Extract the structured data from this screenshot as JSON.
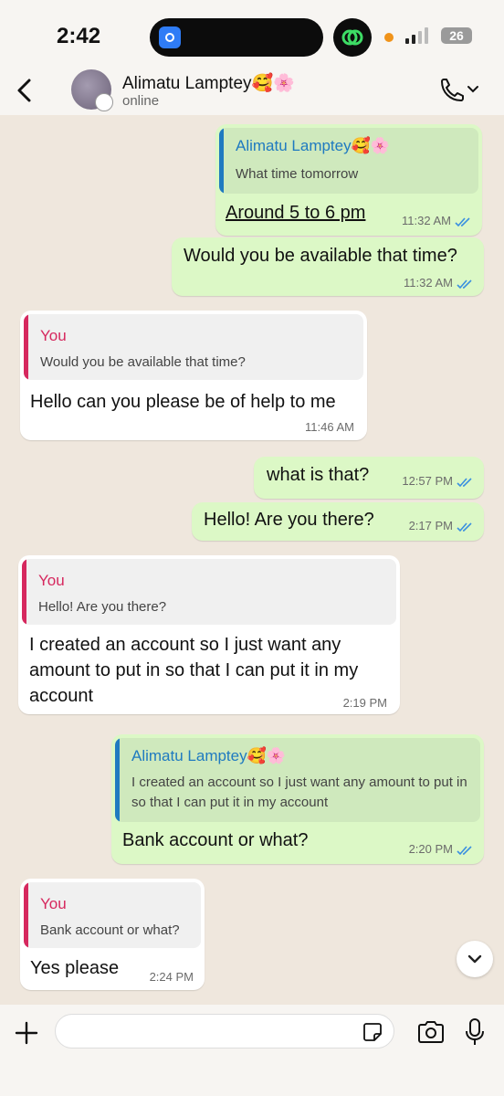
{
  "status_bar": {
    "time": "2:42",
    "battery": "26"
  },
  "header": {
    "contact_name": "Alimatu Lamptey🥰🌸",
    "status": "online"
  },
  "messages": [
    {
      "direction": "out",
      "quote": {
        "author": "Alimatu Lamptey🥰🌸",
        "text": "What time tomorrow"
      },
      "text": "Around 5 to 6 pm",
      "time": "11:32 AM"
    },
    {
      "direction": "out",
      "text": "Would you be available that time?",
      "time": "11:32 AM"
    },
    {
      "direction": "in",
      "quote": {
        "author": "You",
        "text": "Would you be available that time?"
      },
      "text": "Hello can you please be of help to me",
      "time": "11:46 AM"
    },
    {
      "direction": "out",
      "text": "what is that?",
      "time": "12:57 PM"
    },
    {
      "direction": "out",
      "text": "Hello! Are you there?",
      "time": "2:17 PM"
    },
    {
      "direction": "in",
      "quote": {
        "author": "You",
        "text": "Hello! Are you there?"
      },
      "text": "I created an account so I just want any amount to put in so that I can put it in my account",
      "time": "2:19 PM"
    },
    {
      "direction": "out",
      "quote": {
        "author": "Alimatu Lamptey🥰🌸",
        "text": "I created an account so I just want any amount to put in so that I can put it in my account"
      },
      "text": "Bank account or what?",
      "time": "2:20 PM"
    },
    {
      "direction": "in",
      "quote": {
        "author": "You",
        "text": "Bank account or what?"
      },
      "text": "Yes please",
      "time": "2:24 PM"
    }
  ],
  "colors": {
    "outgoing_bubble": "#dcf8c6",
    "incoming_bubble": "#ffffff",
    "read_tick": "#3a8fe0",
    "quote_author_blue": "#1f7ac0",
    "quote_author_red": "#d6285e"
  },
  "icons": [
    "back-icon",
    "call-icon",
    "plus-icon",
    "sticker-icon",
    "camera-icon",
    "mic-icon",
    "chevron-down-icon"
  ]
}
